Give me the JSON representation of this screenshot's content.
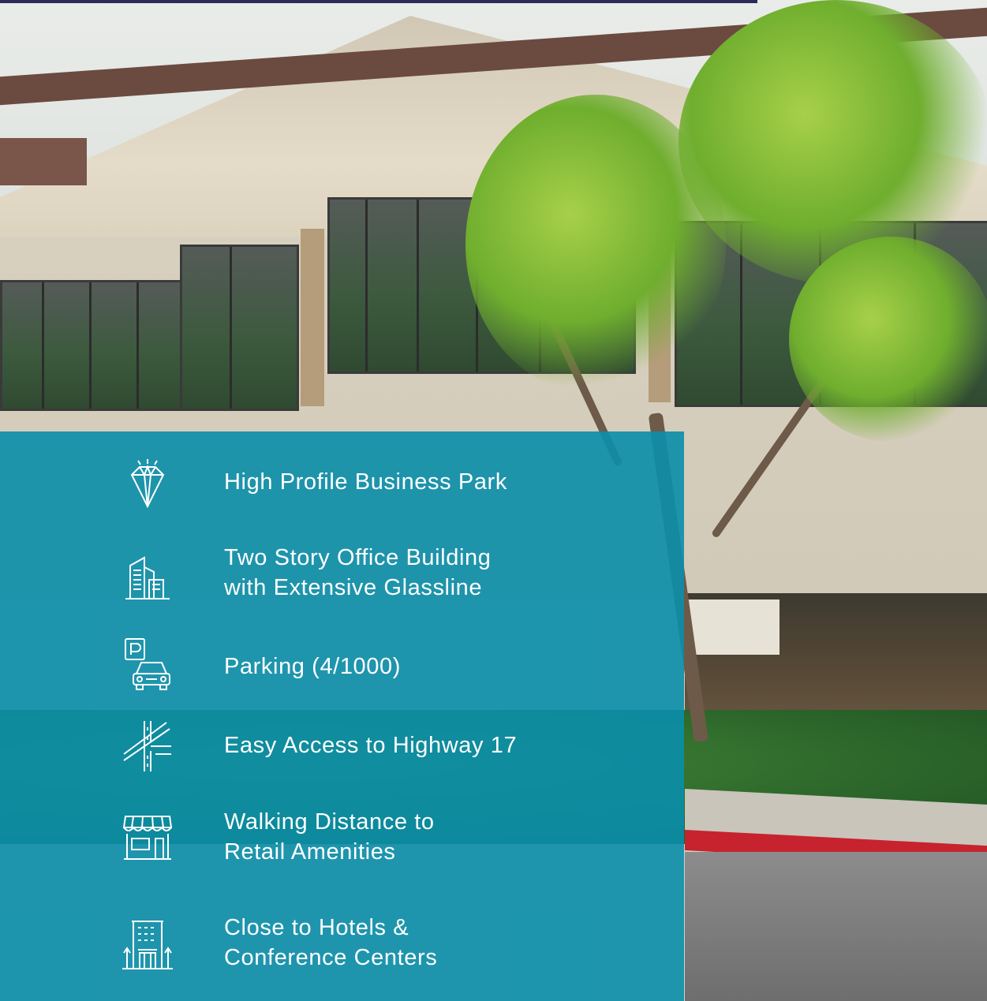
{
  "features": [
    {
      "icon": "diamond-icon",
      "label": "High Profile Business Park"
    },
    {
      "icon": "office-building-icon",
      "label": "Two Story Office Building\nwith Extensive Glassline"
    },
    {
      "icon": "parking-car-icon",
      "label": "Parking (4/1000)"
    },
    {
      "icon": "highway-access-icon",
      "label": "Easy Access to Highway 17"
    },
    {
      "icon": "storefront-icon",
      "label": "Walking Distance to\nRetail Amenities"
    },
    {
      "icon": "hotel-icon",
      "label": "Close to Hotels &\nConference Centers"
    }
  ],
  "colors": {
    "panel": "#0a8eaa",
    "text": "#ffffff",
    "curb": "#c6232f"
  }
}
